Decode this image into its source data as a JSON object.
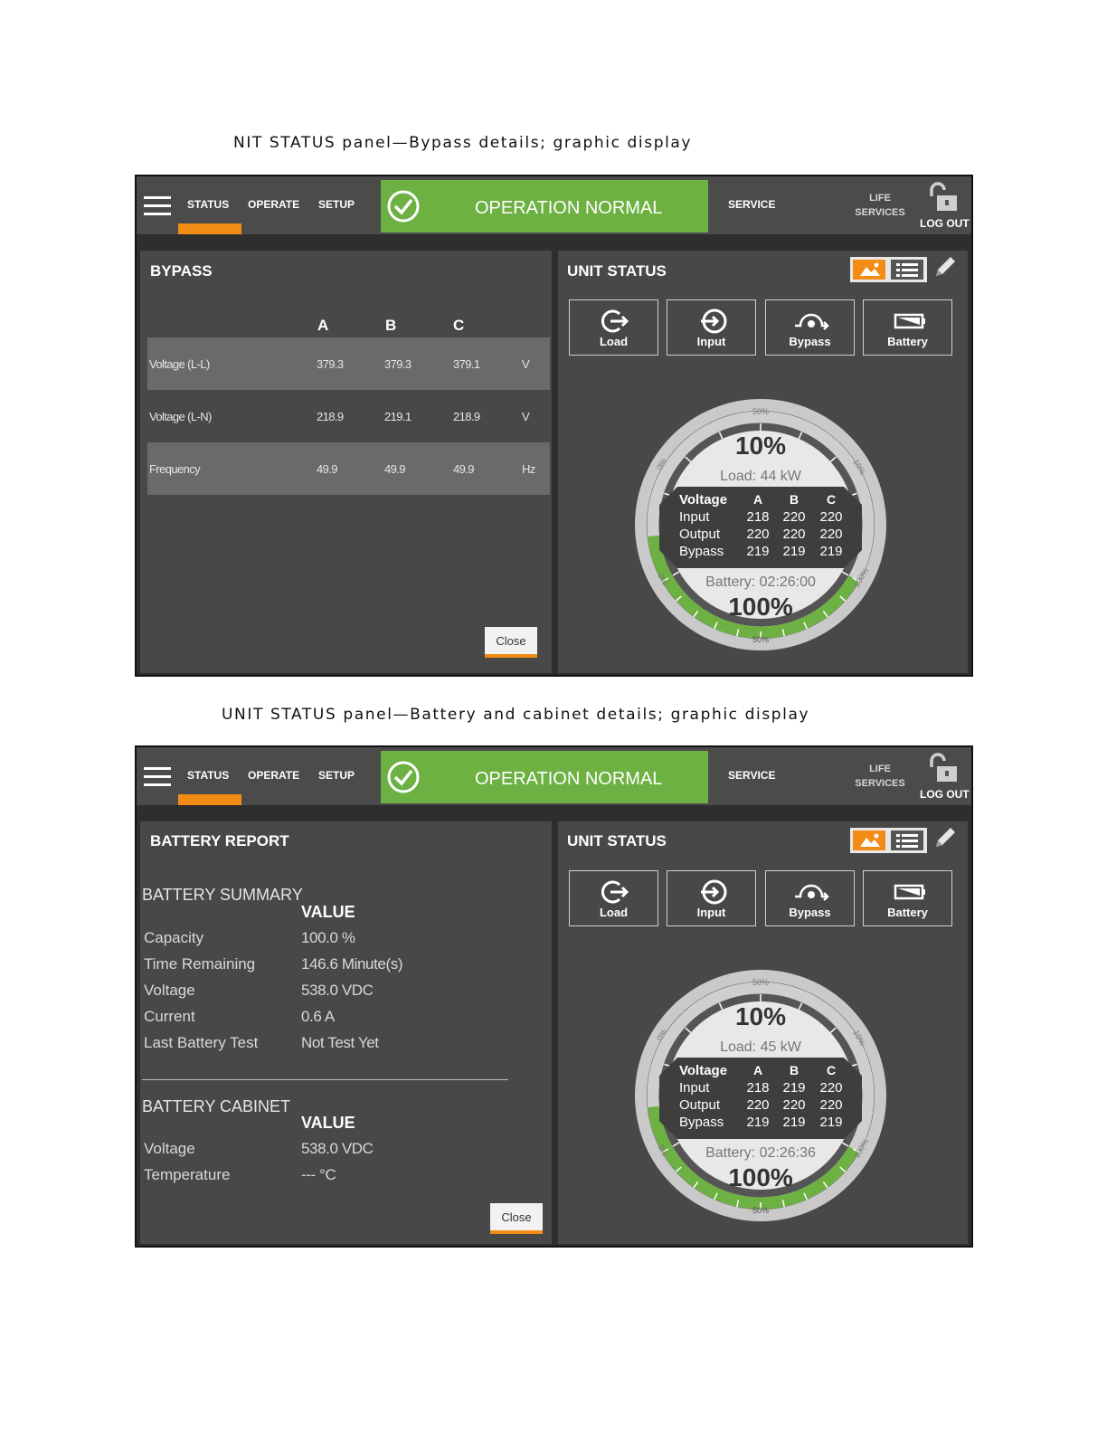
{
  "captions": {
    "top": "NIT STATUS panel—Bypass details; graphic display",
    "bottom": "UNIT STATUS panel—Battery and cabinet details; graphic display"
  },
  "nav": {
    "status": "STATUS",
    "operate": "OPERATE",
    "setup": "SETUP",
    "banner": "OPERATION NORMAL",
    "service": "SERVICE",
    "life_line1": "LIFE",
    "life_line2": "SERVICES",
    "logout": "LOG OUT"
  },
  "colors": {
    "accent_orange": "#f28c14",
    "status_green": "#6db143",
    "panel_gray": "#484848"
  },
  "unit_status": {
    "title": "UNIT STATUS",
    "buttons": [
      "Load",
      "Input",
      "Bypass",
      "Battery"
    ],
    "icons": [
      "load-icon",
      "input-icon",
      "bypass-icon",
      "battery-icon"
    ]
  },
  "gauge_labels": {
    "voltage": "Voltage",
    "cols": [
      "A",
      "B",
      "C"
    ],
    "rows": [
      "Input",
      "Output",
      "Bypass"
    ],
    "tick_top": "50%",
    "tick_bottom": "50%",
    "tick_left_upper": "0%",
    "tick_right_upper": "10%",
    "tick_left_lower": "0%",
    "tick_right_lower": "100%"
  },
  "screen1": {
    "gauge": {
      "load_percent": "10%",
      "load_kw": "Load: 44 kW",
      "input": [
        "218",
        "220",
        "220"
      ],
      "output": [
        "220",
        "220",
        "220"
      ],
      "bypass": [
        "219",
        "219",
        "219"
      ],
      "battery_time": "Battery: 02:26:00",
      "battery_percent": "100%",
      "load_fraction": 0.1,
      "battery_fraction": 1.0
    },
    "bypass": {
      "title": "BYPASS",
      "headers": [
        "A",
        "B",
        "C"
      ],
      "rows": [
        {
          "label": "Voltage (L-L)",
          "a": "379.3",
          "b": "379.3",
          "c": "379.1",
          "unit": "V"
        },
        {
          "label": "Voltage (L-N)",
          "a": "218.9",
          "b": "219.1",
          "c": "218.9",
          "unit": "V"
        },
        {
          "label": "Frequency",
          "a": "49.9",
          "b": "49.9",
          "c": "49.9",
          "unit": "Hz"
        }
      ],
      "close": "Close"
    }
  },
  "screen2": {
    "gauge": {
      "load_percent": "10%",
      "load_kw": "Load: 45 kW",
      "input": [
        "218",
        "219",
        "220"
      ],
      "output": [
        "220",
        "220",
        "220"
      ],
      "bypass": [
        "219",
        "219",
        "219"
      ],
      "battery_time": "Battery: 02:26:36",
      "battery_percent": "100%",
      "load_fraction": 0.1,
      "battery_fraction": 1.0
    },
    "battery": {
      "title": "BATTERY REPORT",
      "summary_title": "BATTERY SUMMARY",
      "value_head": "VALUE",
      "summary": [
        {
          "label": "Capacity",
          "value": "100.0 %"
        },
        {
          "label": "Time Remaining",
          "value": "146.6 Minute(s)"
        },
        {
          "label": "Voltage",
          "value": "538.0 VDC"
        },
        {
          "label": "Current",
          "value": "0.6 A"
        },
        {
          "label": "Last Battery Test",
          "value": "Not Test Yet"
        }
      ],
      "cabinet_title": "BATTERY CABINET",
      "cabinet": [
        {
          "label": "Voltage",
          "value": "538.0 VDC"
        },
        {
          "label": "Temperature",
          "value": "--- °C"
        }
      ],
      "close": "Close"
    }
  }
}
